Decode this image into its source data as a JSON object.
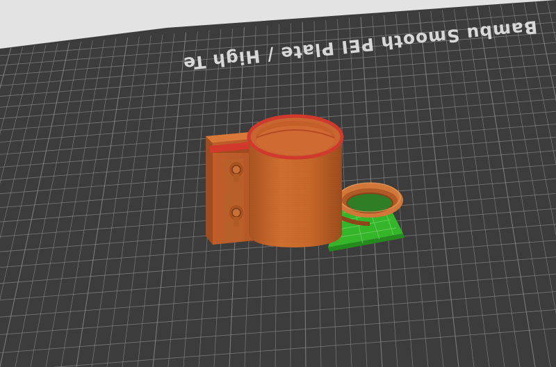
{
  "plate": {
    "label": "Bambu Smooth PEI Plate / High Te"
  },
  "colors": {
    "background": "#e3e3e3",
    "plate": "#3c3c3c",
    "grid_line": "#8a8a8a",
    "grid_major": "#a0a0a0",
    "model_body": "#c8682e",
    "model_shadow": "#9a4a1e",
    "model_highlight": "#e0803e",
    "rim": "#d23a30",
    "support": "#3bbf2e",
    "support_dark": "#2a8f22"
  },
  "icons": {
    "part": "mug-clamp-model",
    "support": "support-structure"
  }
}
